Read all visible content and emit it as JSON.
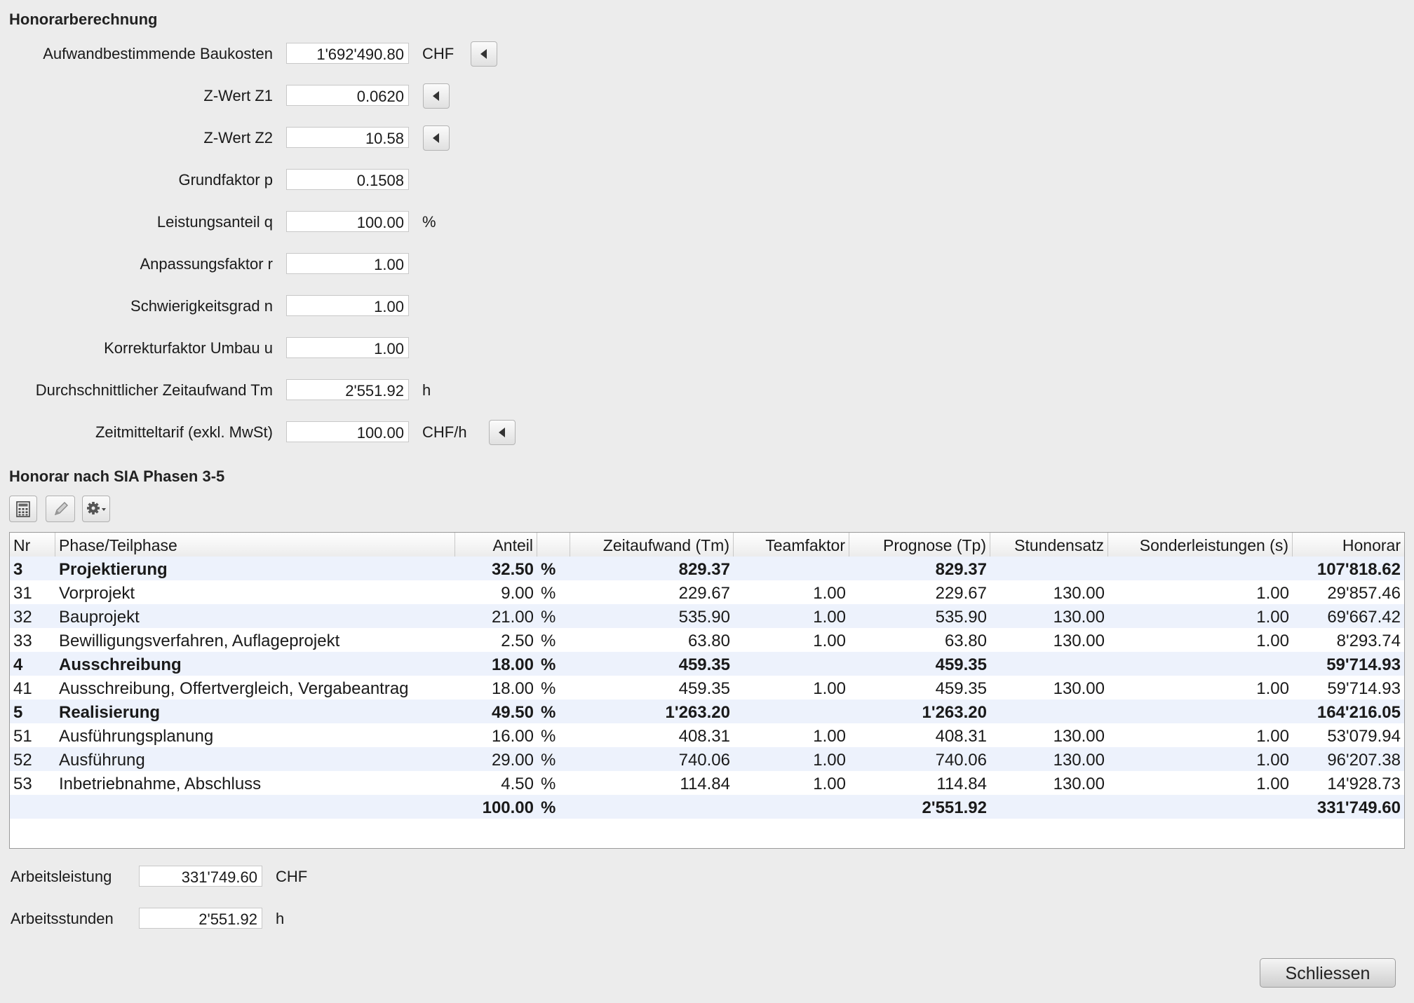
{
  "sections": {
    "calc_title": "Honorarberechnung",
    "phases_title": "Honorar nach SIA Phasen 3-5"
  },
  "form": {
    "baukosten": {
      "label": "Aufwandbestimmende Baukosten",
      "value": "1'692'490.80",
      "unit": "CHF"
    },
    "z1": {
      "label": "Z-Wert Z1",
      "value": "0.0620"
    },
    "z2": {
      "label": "Z-Wert Z2",
      "value": "10.58"
    },
    "p": {
      "label": "Grundfaktor p",
      "value": "0.1508"
    },
    "q": {
      "label": "Leistungsanteil q",
      "value": "100.00",
      "unit": "%"
    },
    "r": {
      "label": "Anpassungsfaktor r",
      "value": "1.00"
    },
    "n": {
      "label": "Schwierigkeitsgrad n",
      "value": "1.00"
    },
    "u": {
      "label": "Korrekturfaktor Umbau u",
      "value": "1.00"
    },
    "tm": {
      "label": "Durchschnittlicher Zeitaufwand Tm",
      "value": "2'551.92",
      "unit": "h"
    },
    "tarif": {
      "label": "Zeitmitteltarif (exkl. MwSt)",
      "value": "100.00",
      "unit": "CHF/h"
    }
  },
  "toolbar": {
    "icons": [
      "calculator-icon",
      "pencil-icon",
      "gear-icon"
    ]
  },
  "table": {
    "columns": [
      "Nr",
      "Phase/Teilphase",
      "Anteil",
      "",
      "Zeitaufwand (Tm)",
      "Teamfaktor",
      "Prognose (Tp)",
      "Stundensatz",
      "Sonderleistungen (s)",
      "Honorar"
    ],
    "rows": [
      {
        "bold": true,
        "cells": [
          "3",
          "Projektierung",
          "32.50",
          "%",
          "829.37",
          "",
          "829.37",
          "",
          "",
          "107'818.62"
        ]
      },
      {
        "bold": false,
        "cells": [
          "31",
          "Vorprojekt",
          "9.00",
          "%",
          "229.67",
          "1.00",
          "229.67",
          "130.00",
          "1.00",
          "29'857.46"
        ]
      },
      {
        "bold": false,
        "cells": [
          "32",
          "Bauprojekt",
          "21.00",
          "%",
          "535.90",
          "1.00",
          "535.90",
          "130.00",
          "1.00",
          "69'667.42"
        ]
      },
      {
        "bold": false,
        "cells": [
          "33",
          "Bewilligungsverfahren, Auflageprojekt",
          "2.50",
          "%",
          "63.80",
          "1.00",
          "63.80",
          "130.00",
          "1.00",
          "8'293.74"
        ]
      },
      {
        "bold": true,
        "cells": [
          "4",
          "Ausschreibung",
          "18.00",
          "%",
          "459.35",
          "",
          "459.35",
          "",
          "",
          "59'714.93"
        ]
      },
      {
        "bold": false,
        "cells": [
          "41",
          "Ausschreibung, Offertvergleich, Vergabeantrag",
          "18.00",
          "%",
          "459.35",
          "1.00",
          "459.35",
          "130.00",
          "1.00",
          "59'714.93"
        ]
      },
      {
        "bold": true,
        "cells": [
          "5",
          "Realisierung",
          "49.50",
          "%",
          "1'263.20",
          "",
          "1'263.20",
          "",
          "",
          "164'216.05"
        ]
      },
      {
        "bold": false,
        "cells": [
          "51",
          "Ausführungsplanung",
          "16.00",
          "%",
          "408.31",
          "1.00",
          "408.31",
          "130.00",
          "1.00",
          "53'079.94"
        ]
      },
      {
        "bold": false,
        "cells": [
          "52",
          "Ausführung",
          "29.00",
          "%",
          "740.06",
          "1.00",
          "740.06",
          "130.00",
          "1.00",
          "96'207.38"
        ]
      },
      {
        "bold": false,
        "cells": [
          "53",
          "Inbetriebnahme, Abschluss",
          "4.50",
          "%",
          "114.84",
          "1.00",
          "114.84",
          "130.00",
          "1.00",
          "14'928.73"
        ]
      },
      {
        "bold": true,
        "cells": [
          "",
          "",
          "100.00",
          "%",
          "",
          "",
          "2'551.92",
          "",
          "",
          "331'749.60"
        ]
      }
    ]
  },
  "summary": {
    "arbeitsleistung": {
      "label": "Arbeitsleistung",
      "value": "331'749.60",
      "unit": "CHF"
    },
    "arbeitsstunden": {
      "label": "Arbeitsstunden",
      "value": "2'551.92",
      "unit": "h"
    }
  },
  "buttons": {
    "close": "Schliessen"
  }
}
